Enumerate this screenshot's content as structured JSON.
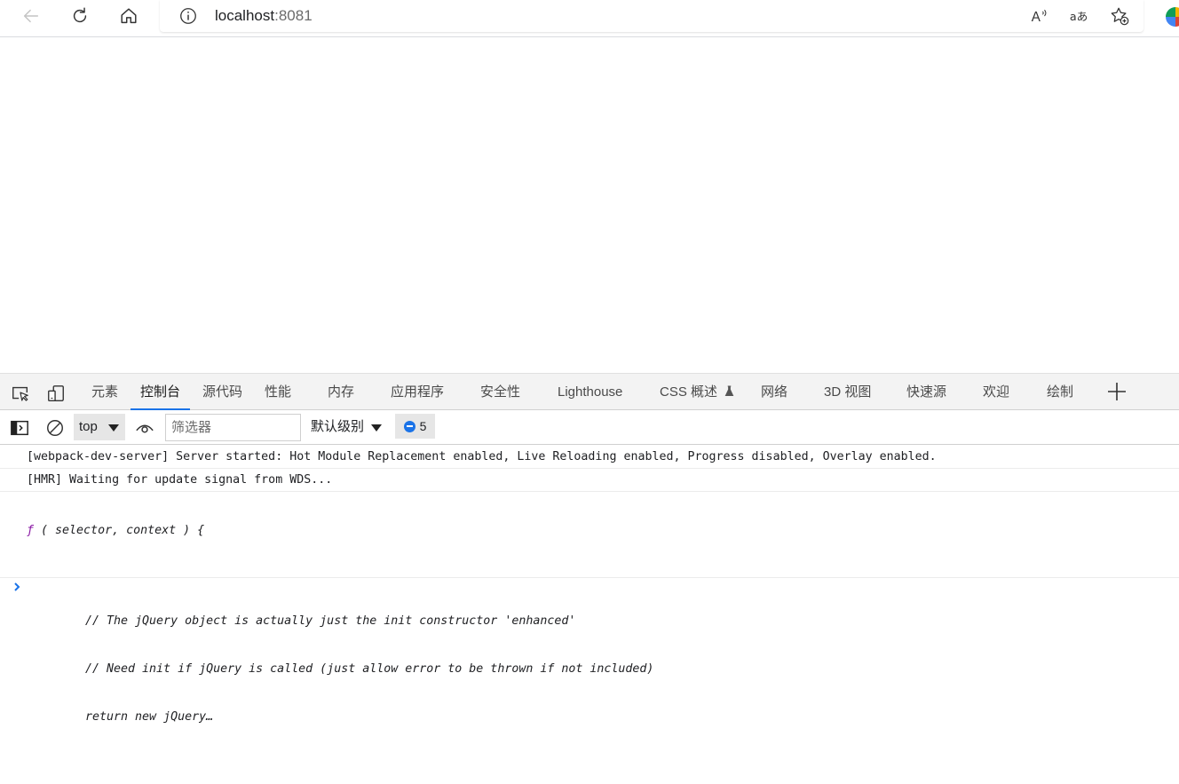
{
  "browser": {
    "url_host": "localhost",
    "url_port": ":8081",
    "nav_icons": [
      "back-arrow-icon",
      "refresh-icon",
      "home-icon"
    ],
    "address_icons": [
      "info-icon",
      "read-aloud-icon",
      "translate-icon",
      "favorite-add-icon"
    ],
    "read_aloud_glyph": "A",
    "translate_glyph": "aあ"
  },
  "devtools": {
    "tabs": [
      {
        "label": "元素"
      },
      {
        "label": "控制台",
        "active": true
      },
      {
        "label": "源代码"
      },
      {
        "label": "性能"
      },
      {
        "label": "内存"
      },
      {
        "label": "应用程序"
      },
      {
        "label": "安全性"
      },
      {
        "label": "Lighthouse"
      },
      {
        "label": "CSS 概述"
      },
      {
        "label": "网络"
      },
      {
        "label": "3D 视图"
      },
      {
        "label": "快速源"
      },
      {
        "label": "欢迎"
      },
      {
        "label": "绘制"
      }
    ],
    "accent": "#1a73e8",
    "console_toolbar": {
      "context": "top",
      "filter_placeholder": "筛选器",
      "level": "默认级别",
      "issues_count": "5"
    },
    "messages": [
      "[webpack-dev-server] Server started: Hot Module Replacement enabled, Live Reloading enabled, Progress disabled, Overlay enabled.",
      "[HMR] Waiting for update signal from WDS..."
    ],
    "function_preview": {
      "f_symbol": "ƒ",
      "signature": " ( selector, context ) {",
      "lines": [
        "// The jQuery object is actually just the init constructor 'enhanced'",
        "// Need init if jQuery is called (just allow error to be thrown if not included)",
        "return new jQuery…"
      ]
    },
    "prompt_color": "#1a73e8"
  }
}
